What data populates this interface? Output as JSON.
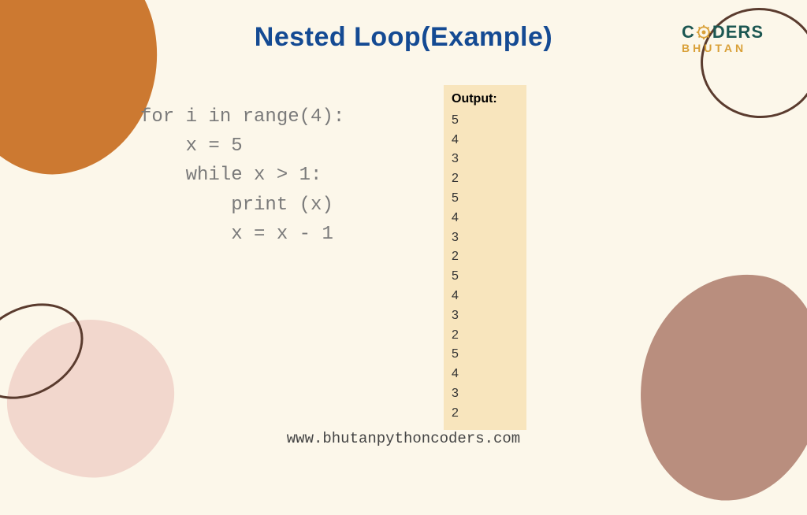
{
  "title": "Nested Loop(Example)",
  "logo": {
    "top_pre": "C",
    "top_post": "DERS",
    "bottom": "BHUTAN"
  },
  "code": {
    "l1": "for i in range(4):",
    "l2": "    x = 5",
    "l3": "    while x > 1:",
    "l4": "        print (x)",
    "l5": "        x = x - 1"
  },
  "output": {
    "label": "Output:",
    "lines": [
      "5",
      "4",
      "3",
      "2",
      "5",
      "4",
      "3",
      "2",
      "5",
      "4",
      "3",
      "2",
      "5",
      "4",
      "3",
      "2"
    ]
  },
  "footer": "www.bhutanpythoncoders.com"
}
